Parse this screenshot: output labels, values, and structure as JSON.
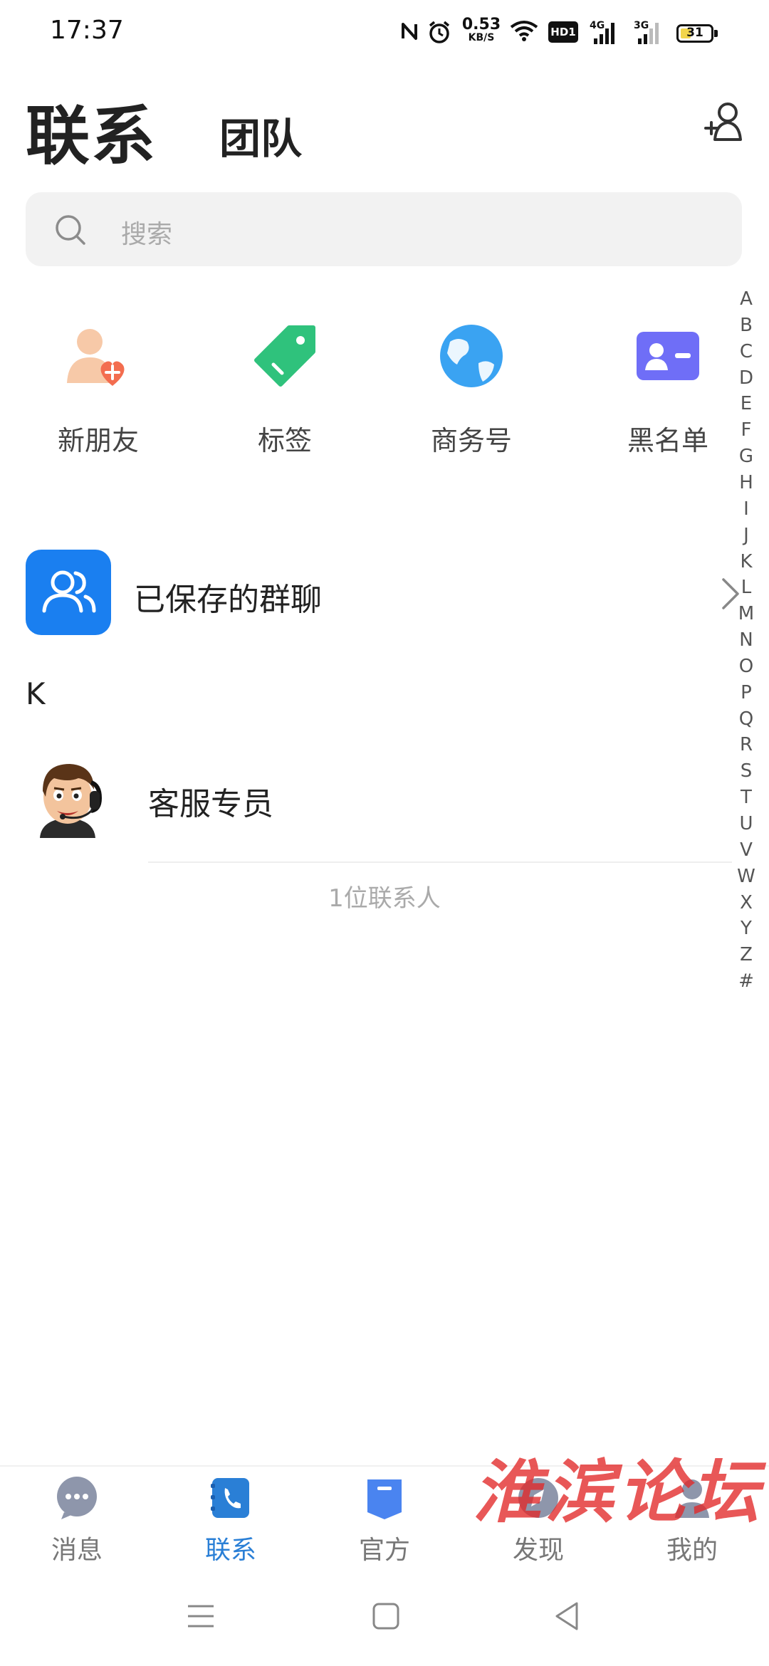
{
  "status_bar": {
    "time": "17:37",
    "net_speed_value": "0.53",
    "net_speed_unit": "KB/S",
    "hd_label": "HD1",
    "sim1_label": "4G",
    "sim2_label": "3G",
    "battery_level": "31",
    "battery_color": "#f2d54a"
  },
  "header": {
    "tab_contacts": "联系",
    "tab_team": "团队"
  },
  "search": {
    "placeholder": "搜索"
  },
  "quick_actions": [
    {
      "label": "新朋友",
      "icon": "new-friend-icon"
    },
    {
      "label": "标签",
      "icon": "tag-icon"
    },
    {
      "label": "商务号",
      "icon": "globe-icon"
    },
    {
      "label": "黑名单",
      "icon": "blacklist-card-icon"
    }
  ],
  "saved_groups": {
    "label": "已保存的群聊",
    "icon": "group-people-icon",
    "color": "#1a7ff0"
  },
  "contacts": {
    "section_letter": "K",
    "items": [
      {
        "name": "客服专员",
        "avatar": "customer-service-avatar"
      }
    ],
    "count_text": "1位联系人"
  },
  "alpha_index": [
    "A",
    "B",
    "C",
    "D",
    "E",
    "F",
    "G",
    "H",
    "I",
    "J",
    "K",
    "L",
    "M",
    "N",
    "O",
    "P",
    "Q",
    "R",
    "S",
    "T",
    "U",
    "V",
    "W",
    "X",
    "Y",
    "Z",
    "#"
  ],
  "bottom_nav": [
    {
      "label": "消息",
      "icon": "chat-bubble-icon",
      "active": false
    },
    {
      "label": "联系",
      "icon": "phone-book-icon",
      "active": true
    },
    {
      "label": "官方",
      "icon": "official-bookmark-icon",
      "active": false
    },
    {
      "label": "发现",
      "icon": "compass-icon",
      "active": false
    },
    {
      "label": "我的",
      "icon": "profile-icon",
      "active": false
    }
  ],
  "watermark": "淮滨论坛",
  "colors": {
    "accent": "#2a7fd6",
    "search_bg": "#f2f2f2",
    "watermark": "#e22828"
  }
}
